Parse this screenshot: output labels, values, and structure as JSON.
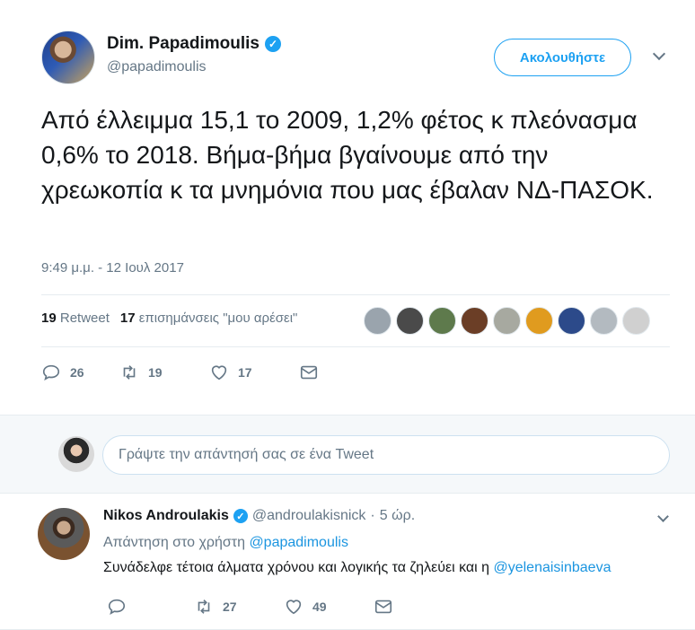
{
  "tweet": {
    "author_name": "Dim. Papadimoulis",
    "author_handle": "@papadimoulis",
    "verified_mark": "✓",
    "follow_label": "Ακολουθήστε",
    "text": "Από έλλειμμα 15,1 το 2009, 1,2% φέτος κ πλεόνασμα 0,6% το 2018. Βήμα-βήμα βγαίνουμε από την χρεωκοπία κ τα μνημόνια που μας έβαλαν ΝΔ-ΠΑΣΟΚ.",
    "timestamp": "9:49 μ.μ. - 12 Ιουλ 2017",
    "retweet_count": "19",
    "retweet_label": "Retweet",
    "like_count": "17",
    "like_label": "επισημάνσεις \"μου αρέσει\"",
    "actions": {
      "replies": "26",
      "retweets": "19",
      "likes": "17"
    },
    "liker_colors": [
      "#9aa4ad",
      "#4a4a4a",
      "#5e7a4c",
      "#6b3e26",
      "#a7a9a0",
      "#e09b1f",
      "#2c4a8a",
      "#b3bac0",
      "#d0d0d0"
    ]
  },
  "reply_box": {
    "placeholder": "Γράψτε την απάντησή σας σε ένα Tweet"
  },
  "reply": {
    "author_name": "Nikos Androulakis",
    "author_handle": "@androulakisnick",
    "separator": "·",
    "time": "5 ώρ.",
    "reply_to_prefix": "Απάντηση στο χρήστη",
    "reply_to_handle": "@papadimoulis",
    "text": "Συνάδελφε τέτοια άλματα χρόνου και λογικής τα ζηλεύει και η",
    "mention": "@yelenaisinbaeva",
    "actions": {
      "replies": "",
      "retweets": "27",
      "likes": "49"
    }
  },
  "colors": {
    "accent": "#1da1f2",
    "muted": "#657786",
    "text": "#14171a",
    "link": "#1b95e0"
  },
  "icons": [
    "reply-icon",
    "retweet-icon",
    "heart-icon",
    "message-icon",
    "chevron-down-icon",
    "verified-icon"
  ]
}
